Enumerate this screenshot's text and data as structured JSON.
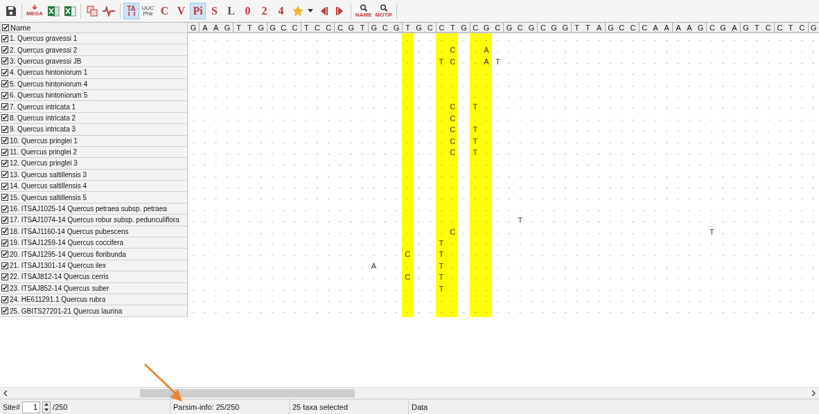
{
  "toolbar": [
    {
      "kind": "save"
    },
    {
      "kind": "separator"
    },
    {
      "kind": "export",
      "label": "MEGA"
    },
    {
      "kind": "excel"
    },
    {
      "kind": "excel-alt"
    },
    {
      "kind": "separator"
    },
    {
      "kind": "copy"
    },
    {
      "kind": "pulse"
    },
    {
      "kind": "separator"
    },
    {
      "kind": "toggle-ta",
      "label": "TA",
      "selected": true
    },
    {
      "kind": "codon",
      "top": "UUC",
      "bottom": "Phe",
      "selected": false
    },
    {
      "kind": "letter",
      "label": "C",
      "selected": false
    },
    {
      "kind": "letter",
      "label": "V",
      "selected": false
    },
    {
      "kind": "letter",
      "label": "Pi",
      "selected": true
    },
    {
      "kind": "letter",
      "label": "S",
      "selected": false
    },
    {
      "kind": "letter-dark",
      "label": "L",
      "selected": false
    },
    {
      "kind": "letter",
      "label": "0",
      "selected": false
    },
    {
      "kind": "letter",
      "label": "2",
      "selected": false
    },
    {
      "kind": "letter",
      "label": "4",
      "selected": false
    },
    {
      "kind": "star"
    },
    {
      "kind": "dropdown"
    },
    {
      "kind": "prev"
    },
    {
      "kind": "next"
    },
    {
      "kind": "separator"
    },
    {
      "kind": "search",
      "label": "NAME"
    },
    {
      "kind": "search",
      "label": "MOTIF"
    },
    {
      "kind": "separator"
    }
  ],
  "name_header": {
    "label": "Name",
    "checked": true
  },
  "sites": [
    {
      "base": "G",
      "highlighted": false
    },
    {
      "base": "A",
      "highlighted": false
    },
    {
      "base": "A",
      "highlighted": false
    },
    {
      "base": "G",
      "highlighted": false
    },
    {
      "base": "T",
      "highlighted": false
    },
    {
      "base": "T",
      "highlighted": false
    },
    {
      "base": "G",
      "highlighted": false
    },
    {
      "base": "G",
      "highlighted": false
    },
    {
      "base": "C",
      "highlighted": false
    },
    {
      "base": "C",
      "highlighted": false
    },
    {
      "base": "T",
      "highlighted": false
    },
    {
      "base": "C",
      "highlighted": false
    },
    {
      "base": "C",
      "highlighted": false
    },
    {
      "base": "C",
      "highlighted": false
    },
    {
      "base": "G",
      "highlighted": false
    },
    {
      "base": "T",
      "highlighted": false
    },
    {
      "base": "G",
      "highlighted": false
    },
    {
      "base": "C",
      "highlighted": false
    },
    {
      "base": "G",
      "highlighted": false
    },
    {
      "base": "T",
      "highlighted": true
    },
    {
      "base": "G",
      "highlighted": false
    },
    {
      "base": "C",
      "highlighted": false
    },
    {
      "base": "C",
      "highlighted": true
    },
    {
      "base": "T",
      "highlighted": true
    },
    {
      "base": "G",
      "highlighted": false
    },
    {
      "base": "C",
      "highlighted": true
    },
    {
      "base": "G",
      "highlighted": true
    },
    {
      "base": "C",
      "highlighted": false
    },
    {
      "base": "G",
      "highlighted": false
    },
    {
      "base": "C",
      "highlighted": false
    },
    {
      "base": "G",
      "highlighted": false
    },
    {
      "base": "C",
      "highlighted": false
    },
    {
      "base": "G",
      "highlighted": false
    },
    {
      "base": "G",
      "highlighted": false
    },
    {
      "base": "T",
      "highlighted": false
    },
    {
      "base": "T",
      "highlighted": false
    },
    {
      "base": "A",
      "highlighted": false
    },
    {
      "base": "G",
      "highlighted": false
    },
    {
      "base": "C",
      "highlighted": false
    },
    {
      "base": "C",
      "highlighted": false
    },
    {
      "base": "C",
      "highlighted": false
    },
    {
      "base": "A",
      "highlighted": false
    },
    {
      "base": "A",
      "highlighted": false
    },
    {
      "base": "A",
      "highlighted": false
    },
    {
      "base": "A",
      "highlighted": false
    },
    {
      "base": "G",
      "highlighted": false
    },
    {
      "base": "C",
      "highlighted": false
    },
    {
      "base": "G",
      "highlighted": false
    },
    {
      "base": "A",
      "highlighted": false
    },
    {
      "base": "G",
      "highlighted": false
    },
    {
      "base": "T",
      "highlighted": false
    },
    {
      "base": "C",
      "highlighted": false
    },
    {
      "base": "C",
      "highlighted": false
    },
    {
      "base": "T",
      "highlighted": false
    },
    {
      "base": "C",
      "highlighted": false
    },
    {
      "base": "G",
      "highlighted": false
    }
  ],
  "rows": [
    {
      "name": "1. Quercus gravessi 1",
      "checked": true,
      "sequence": ". . . . . . . . . . . . . . . . . . . . . . . . . . . . . . . . . . . . . . . . . . . . . . . . . . . . . . . ."
    },
    {
      "name": "2. Quercus gravessi 2",
      "checked": true,
      "sequence": ". . . . . . . . . . . . . . . . . . . . . . . C . . A . . . . . . . . . . . . . . . . . . . . . . . . . . . . ."
    },
    {
      "name": "3. Quercus gravessi JB",
      "checked": true,
      "sequence": ". . . . . . . . . . . . . . . . . . . . . . T C . . A T . . . . . . . . . . . . . . . . . . . . . . . . . . . ."
    },
    {
      "name": "4. Quercus hintoniorum 1",
      "checked": true,
      "sequence": ". . . . . . . . . . . . . . . . . . . . . . . . . . . . . . . . . . . . . . . . . . . . . . . . . . . . . . . ."
    },
    {
      "name": "5. Quercus hintoniorum 4",
      "checked": true,
      "sequence": ". . . . . . . . . . . . . . . . . . . . . . . . . . . . . . . . . . . . . . . . . . . . . . . . . . . . . . . ."
    },
    {
      "name": "6. Quercus hintoniorum 5",
      "checked": true,
      "sequence": ". . . . . . . . . . . . . . . . . . . . . . . . . . . . . . . . . . . . . . . . . . . . . . . . . . . . . . . ."
    },
    {
      "name": "7. Quercus intricata 1",
      "checked": true,
      "sequence": ". . . . . . . . . . . . . . . . . . . . . . . C . T . . . . . . . . . . . . . . . . . . . . . . . . . . . . . ."
    },
    {
      "name": "8. Quercus intricata 2",
      "checked": true,
      "sequence": ". . . . . . . . . . . . . . . . . . . . . . . C . . . . . . . . . . . . . . . . . . . . . . . . . . . . . . . ."
    },
    {
      "name": "9. Quercus intricata 3",
      "checked": true,
      "sequence": ". . . . . . . . . . . . . . . . . . . . . . . C . T . . . . . . . . . . . . . . . . . . . . . . . . . . . . . ."
    },
    {
      "name": "10. Quercus pringlei 1",
      "checked": true,
      "sequence": ". . . . . . . . . . . . . . . . . . . . . . . C . T . . . . . . . . . . . . . . . . . . . . . . . . . . . . . ."
    },
    {
      "name": "11. Quercus pringlei 2",
      "checked": true,
      "sequence": ". . . . . . . . . . . . . . . . . . . . . . . C . T . . . . . . . . . . . . . . . . . . . . . . . . . . . . . ."
    },
    {
      "name": "12. Quercus pringlei 3",
      "checked": true,
      "sequence": ". . . . . . . . . . . . . . . . . . . . . . . . . . . . . . . . . . . . . . . . . . . . . . . . . . . . . . . ."
    },
    {
      "name": "13. Quercus saltillensis 3",
      "checked": true,
      "sequence": ". . . . . . . . . . . . . . . . . . . . . . . . . . . . . . . . . . . . . . . . . . . . . . . . . . . . . . . ."
    },
    {
      "name": "14. Quercus saltillensis 4",
      "checked": true,
      "sequence": ". . . . . . . . . . . . . . . . . . . . . . . . . . . . . . . . . . . . . . . . . . . . . . . . . . . . . . . ."
    },
    {
      "name": "15. Quercus saltillensis 5",
      "checked": true,
      "sequence": ". . . . . . . . . . . . . . . . . . . . . . . . . . . . . . . . . . . . . . . . . . . . . . . . . . . . . . . ."
    },
    {
      "name": "16. ITSAJ1025-14 Quercus petraea subsp. petraea",
      "checked": true,
      "sequence": ". . . . . . . . . . . . . . . . . . . . . . . . . . . . . . . . . . . . . . . . . . . . . . . . . . . . . . . ."
    },
    {
      "name": "17. ITSAJ1074-14 Quercus robur subsp. pedunculiflora",
      "checked": true,
      "sequence": ". . . . . . . . . . . . . . . . . . . . . . . . . . . . . T . . . . . . . . . . . . . . . . . . . . . . . . . ."
    },
    {
      "name": "18. ITSAJ1160-14 Quercus pubescens",
      "checked": true,
      "sequence": ". . . . . . . . . . . . . . . . . . . . . . . C . . . . . . . . . . . . . . . . . . . . . . T . . . . . . . . ."
    },
    {
      "name": "19. ITSAJ1259-14 Quercus coccifera",
      "checked": true,
      "sequence": ". . . . . . . . . . . . . . . . . . . . . . T . . . . . . . . . . . . . . . . . . . . . . . . . . . . . . . . ."
    },
    {
      "name": "20. ITSAJ1295-14 Quercus floribunda",
      "checked": true,
      "sequence": ". . . . . . . . . . . . . . . . . . . C . . T . . . . . . . . . . . . . . . . . . . . . . . . . . . . . . . . ."
    },
    {
      "name": "21. ITSAJ1301-14 Quercus ilex",
      "checked": true,
      "sequence": ". . . . . . . . . . . . . . . . A . . . . . T . . . . . . . . . . . . . . . . . . . . . . . . . . . . . . . . ."
    },
    {
      "name": "22. ITSAJ812-14 Quercus cerris",
      "checked": true,
      "sequence": ". . . . . . . . . . . . . . . . . . . C . . T . . . . . . . . . . . . . . . . . . . . . . . . . . . . . . . . ."
    },
    {
      "name": "23. ITSAJ852-14 Quercus suber",
      "checked": true,
      "sequence": ". . . . . . . . . . . . . . . . . . . . . . T . . . . . . . . . . . . . . . . . . . . . . . . . . . . . . . . ."
    },
    {
      "name": "24. HE611291.1 Quercus rubra",
      "checked": true,
      "sequence": ". . . . . . . . . . . . . . . . . . . . . . . . . . . . . . . . . . . . . . . . . . . . . . . . . . . . . . . ."
    },
    {
      "name": "25. GBITS27201-21 Quercus laurina",
      "checked": true,
      "sequence": ". . . . . . . . . . . . . . . . . . . . . . . . . . . . . . . . . . . . . . . . . . . . . . . . . . . . . . . ."
    }
  ],
  "status_bar": {
    "site_label": "Site#",
    "site_value": "1",
    "site_total": "/250",
    "parsim_info": "Parsim-info: 25/250",
    "taxa_selected": "25 taxa selected",
    "mode": "Data"
  }
}
